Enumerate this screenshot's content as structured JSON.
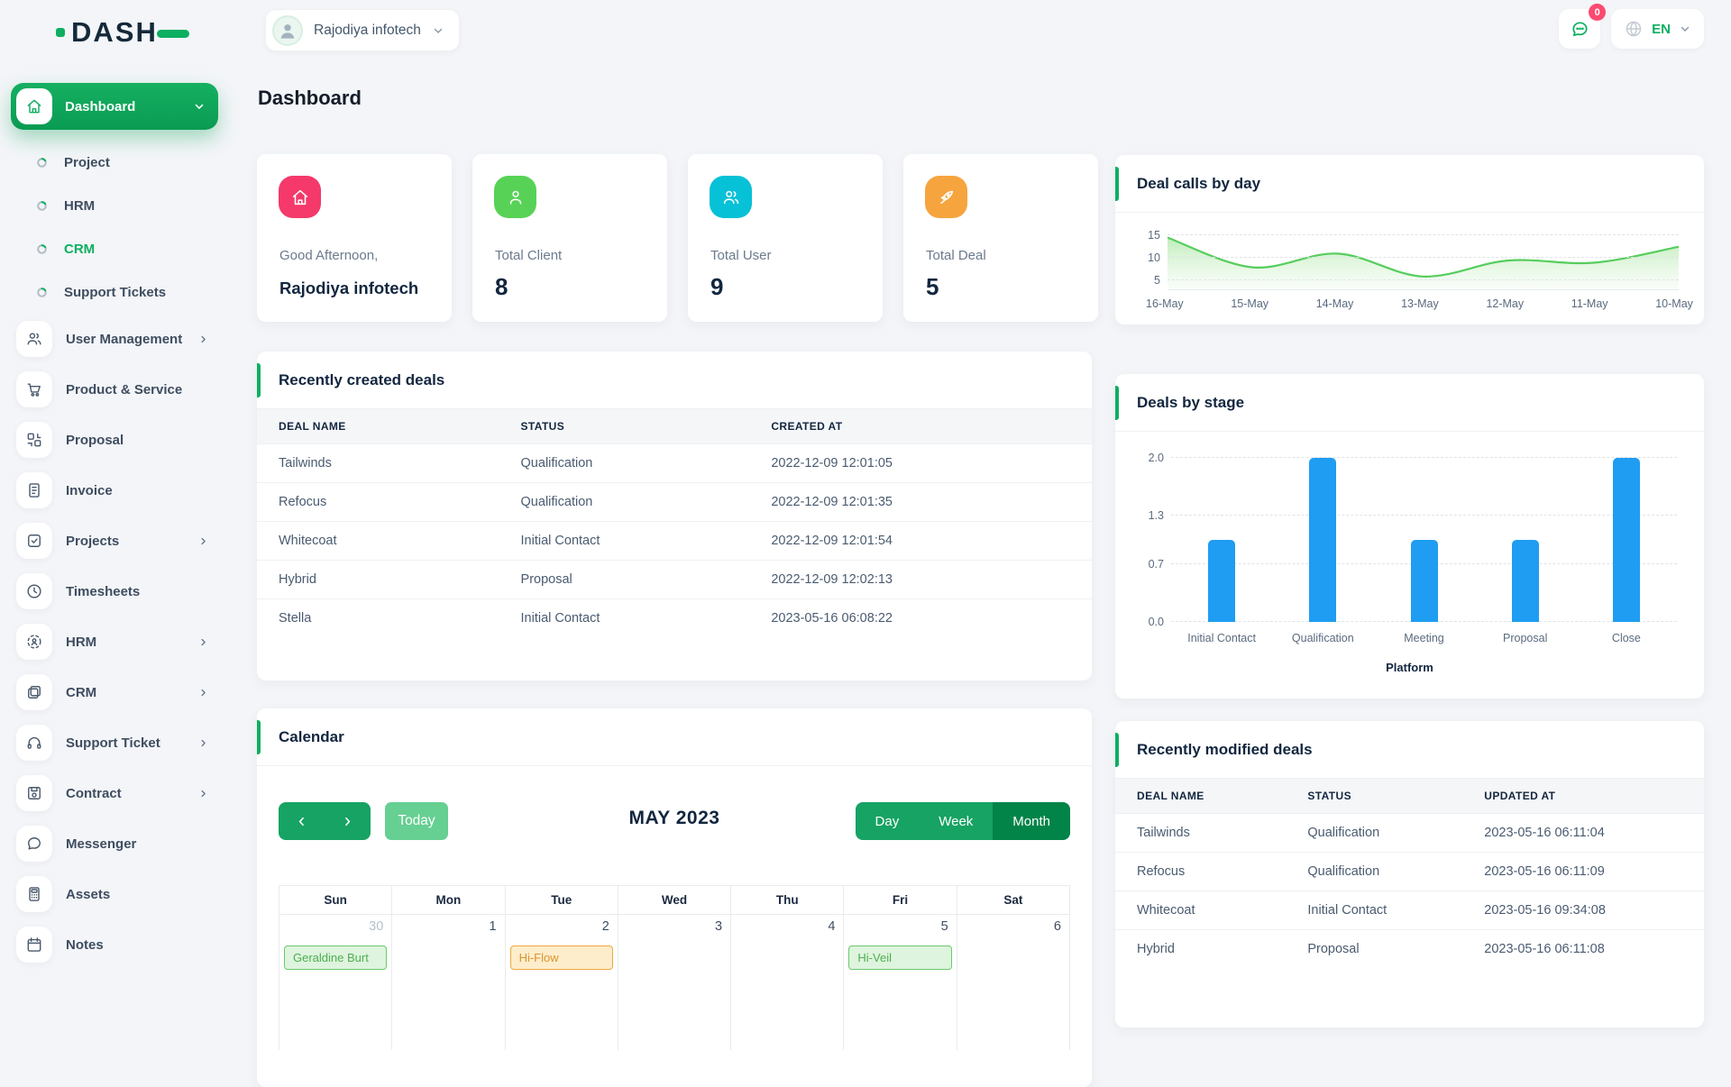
{
  "brand": {
    "name": "DASH"
  },
  "topbar": {
    "company": "Rajodiya infotech",
    "messages_badge": "0",
    "language": "EN"
  },
  "page": {
    "title": "Dashboard"
  },
  "sidebar": {
    "items": [
      {
        "label": "Dashboard",
        "type": "active",
        "icon": "home",
        "expandable": true
      },
      {
        "label": "Project",
        "type": "sub"
      },
      {
        "label": "HRM",
        "type": "sub"
      },
      {
        "label": "CRM",
        "type": "sub",
        "active": true
      },
      {
        "label": "Support Tickets",
        "type": "sub"
      },
      {
        "label": "User Management",
        "type": "item",
        "icon": "users",
        "chevron": true
      },
      {
        "label": "Product & Service",
        "type": "item",
        "icon": "cart"
      },
      {
        "label": "Proposal",
        "type": "item",
        "icon": "proposal"
      },
      {
        "label": "Invoice",
        "type": "item",
        "icon": "invoice"
      },
      {
        "label": "Projects",
        "type": "item",
        "icon": "check-square",
        "chevron": true
      },
      {
        "label": "Timesheets",
        "type": "item",
        "icon": "clock"
      },
      {
        "label": "HRM",
        "type": "item",
        "icon": "hrm",
        "chevron": true
      },
      {
        "label": "CRM",
        "type": "item",
        "icon": "crm",
        "chevron": true
      },
      {
        "label": "Support Ticket",
        "type": "item",
        "icon": "headphones",
        "chevron": true
      },
      {
        "label": "Contract",
        "type": "item",
        "icon": "save",
        "chevron": true
      },
      {
        "label": "Messenger",
        "type": "item",
        "icon": "chat"
      },
      {
        "label": "Assets",
        "type": "item",
        "icon": "calculator"
      },
      {
        "label": "Notes",
        "type": "item",
        "icon": "calendar"
      }
    ]
  },
  "stat_cards": [
    {
      "icon": "home",
      "color": "#f5396b",
      "label": "Good Afternoon,",
      "value": "Rajodiya infotech",
      "text_value": true
    },
    {
      "icon": "user",
      "color": "#57d256",
      "label": "Total Client",
      "value": "8"
    },
    {
      "icon": "users",
      "color": "#07c1d6",
      "label": "Total User",
      "value": "9"
    },
    {
      "icon": "rocket",
      "color": "#f6a43e",
      "label": "Total Deal",
      "value": "5"
    }
  ],
  "chart_data": [
    {
      "id": "deal_calls_by_day",
      "type": "area",
      "title": "Deal calls by day",
      "x": [
        "16-May",
        "15-May",
        "14-May",
        "13-May",
        "12-May",
        "11-May",
        "10-May"
      ],
      "values": [
        14.5,
        8,
        11,
        6,
        9.5,
        9,
        12.5
      ],
      "yticks": [
        15,
        10,
        5
      ],
      "ylim": [
        3,
        16
      ],
      "color": "#56cd5c",
      "grid": "dashed horizontal",
      "legend": "none"
    },
    {
      "id": "deals_by_stage",
      "type": "bar",
      "title": "Deals by stage",
      "categories": [
        "Initial Contact",
        "Qualification",
        "Meeting",
        "Proposal",
        "Close"
      ],
      "values": [
        1,
        2,
        1,
        1,
        2
      ],
      "yticks": [
        "2.0",
        "1.3",
        "0.7",
        "0.0"
      ],
      "ylim": [
        0,
        2
      ],
      "xlabel": "Platform",
      "color": "#1e9df2",
      "grid": "dashed horizontal",
      "legend": "none"
    }
  ],
  "recent_created": {
    "title": "Recently created deals",
    "columns": [
      "DEAL NAME",
      "STATUS",
      "CREATED AT"
    ],
    "rows": [
      [
        "Tailwinds",
        "Qualification",
        "2022-12-09 12:01:05"
      ],
      [
        "Refocus",
        "Qualification",
        "2022-12-09 12:01:35"
      ],
      [
        "Whitecoat",
        "Initial Contact",
        "2022-12-09 12:01:54"
      ],
      [
        "Hybrid",
        "Proposal",
        "2022-12-09 12:02:13"
      ],
      [
        "Stella",
        "Initial Contact",
        "2023-05-16 06:08:22"
      ]
    ]
  },
  "recent_modified": {
    "title": "Recently modified deals",
    "columns": [
      "DEAL NAME",
      "STATUS",
      "UPDATED AT"
    ],
    "rows": [
      [
        "Tailwinds",
        "Qualification",
        "2023-05-16 06:11:04"
      ],
      [
        "Refocus",
        "Qualification",
        "2023-05-16 06:11:09"
      ],
      [
        "Whitecoat",
        "Initial Contact",
        "2023-05-16 09:34:08"
      ],
      [
        "Hybrid",
        "Proposal",
        "2023-05-16 06:11:08"
      ]
    ]
  },
  "calendar": {
    "title": "Calendar",
    "month": "MAY 2023",
    "today_label": "Today",
    "views": [
      "Day",
      "Week",
      "Month"
    ],
    "active_view": "Month",
    "weekdays": [
      "Sun",
      "Mon",
      "Tue",
      "Wed",
      "Thu",
      "Fri",
      "Sat"
    ],
    "week": [
      {
        "date": "30",
        "muted": true,
        "event": {
          "label": "Geraldine Burt",
          "color": "green"
        }
      },
      {
        "date": "1"
      },
      {
        "date": "2",
        "event": {
          "label": "Hi-Flow",
          "color": "orange"
        }
      },
      {
        "date": "3"
      },
      {
        "date": "4"
      },
      {
        "date": "5",
        "event": {
          "label": "Hi-Veil",
          "color": "green"
        }
      },
      {
        "date": "6"
      }
    ]
  }
}
